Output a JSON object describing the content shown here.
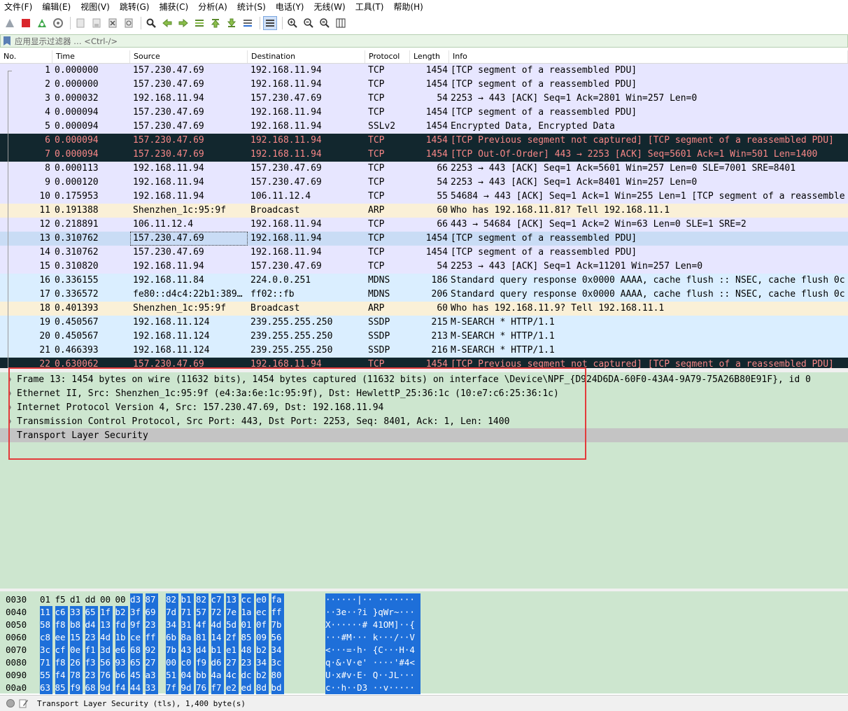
{
  "menu": [
    "文件(F)",
    "编辑(E)",
    "视图(V)",
    "跳转(G)",
    "捕获(C)",
    "分析(A)",
    "统计(S)",
    "电话(Y)",
    "无线(W)",
    "工具(T)",
    "帮助(H)"
  ],
  "filter": {
    "placeholder": "应用显示过滤器 … <Ctrl-/>"
  },
  "columns": [
    "No.",
    "Time",
    "Source",
    "Destination",
    "Protocol",
    "Length",
    "Info"
  ],
  "packets": [
    {
      "no": "1",
      "time": "0.000000",
      "src": "157.230.47.69",
      "dst": "192.168.11.94",
      "proto": "TCP",
      "len": "1454",
      "info": "[TCP segment of a reassembled PDU]",
      "cat": "tcp"
    },
    {
      "no": "2",
      "time": "0.000000",
      "src": "157.230.47.69",
      "dst": "192.168.11.94",
      "proto": "TCP",
      "len": "1454",
      "info": "[TCP segment of a reassembled PDU]",
      "cat": "tcp"
    },
    {
      "no": "3",
      "time": "0.000032",
      "src": "192.168.11.94",
      "dst": "157.230.47.69",
      "proto": "TCP",
      "len": "54",
      "info": "2253 → 443 [ACK] Seq=1 Ack=2801 Win=257 Len=0",
      "cat": "tcp"
    },
    {
      "no": "4",
      "time": "0.000094",
      "src": "157.230.47.69",
      "dst": "192.168.11.94",
      "proto": "TCP",
      "len": "1454",
      "info": "[TCP segment of a reassembled PDU]",
      "cat": "tcp"
    },
    {
      "no": "5",
      "time": "0.000094",
      "src": "157.230.47.69",
      "dst": "192.168.11.94",
      "proto": "SSLv2",
      "len": "1454",
      "info": "Encrypted Data, Encrypted Data",
      "cat": "tcp"
    },
    {
      "no": "6",
      "time": "0.000094",
      "src": "157.230.47.69",
      "dst": "192.168.11.94",
      "proto": "TCP",
      "len": "1454",
      "info": "[TCP Previous segment not captured]  [TCP segment of a reassembled PDU]",
      "cat": "bad"
    },
    {
      "no": "7",
      "time": "0.000094",
      "src": "157.230.47.69",
      "dst": "192.168.11.94",
      "proto": "TCP",
      "len": "1454",
      "info": "[TCP Out-Of-Order] 443 → 2253 [ACK] Seq=5601 Ack=1 Win=501 Len=1400",
      "cat": "bad"
    },
    {
      "no": "8",
      "time": "0.000113",
      "src": "192.168.11.94",
      "dst": "157.230.47.69",
      "proto": "TCP",
      "len": "66",
      "info": "2253 → 443 [ACK] Seq=1 Ack=5601 Win=257 Len=0 SLE=7001 SRE=8401",
      "cat": "tcp"
    },
    {
      "no": "9",
      "time": "0.000120",
      "src": "192.168.11.94",
      "dst": "157.230.47.69",
      "proto": "TCP",
      "len": "54",
      "info": "2253 → 443 [ACK] Seq=1 Ack=8401 Win=257 Len=0",
      "cat": "tcp"
    },
    {
      "no": "10",
      "time": "0.175953",
      "src": "192.168.11.94",
      "dst": "106.11.12.4",
      "proto": "TCP",
      "len": "55",
      "info": "54684 → 443 [ACK] Seq=1 Ack=1 Win=255 Len=1 [TCP segment of a reassemble",
      "cat": "tcp"
    },
    {
      "no": "11",
      "time": "0.191388",
      "src": "Shenzhen_1c:95:9f",
      "dst": "Broadcast",
      "proto": "ARP",
      "len": "60",
      "info": "Who has 192.168.11.81? Tell 192.168.11.1",
      "cat": "arp"
    },
    {
      "no": "12",
      "time": "0.218891",
      "src": "106.11.12.4",
      "dst": "192.168.11.94",
      "proto": "TCP",
      "len": "66",
      "info": "443 → 54684 [ACK] Seq=1 Ack=2 Win=63 Len=0 SLE=1 SRE=2",
      "cat": "tcp"
    },
    {
      "no": "13",
      "time": "0.310762",
      "src": "157.230.47.69",
      "dst": "192.168.11.94",
      "proto": "TCP",
      "len": "1454",
      "info": "[TCP segment of a reassembled PDU]",
      "cat": "sel"
    },
    {
      "no": "14",
      "time": "0.310762",
      "src": "157.230.47.69",
      "dst": "192.168.11.94",
      "proto": "TCP",
      "len": "1454",
      "info": "[TCP segment of a reassembled PDU]",
      "cat": "tcp"
    },
    {
      "no": "15",
      "time": "0.310820",
      "src": "192.168.11.94",
      "dst": "157.230.47.69",
      "proto": "TCP",
      "len": "54",
      "info": "2253 → 443 [ACK] Seq=1 Ack=11201 Win=257 Len=0",
      "cat": "tcp"
    },
    {
      "no": "16",
      "time": "0.336155",
      "src": "192.168.11.84",
      "dst": "224.0.0.251",
      "proto": "MDNS",
      "len": "186",
      "info": "Standard query response 0x0000 AAAA, cache flush :: NSEC, cache flush 0c",
      "cat": "udp"
    },
    {
      "no": "17",
      "time": "0.336572",
      "src": "fe80::d4c4:22b1:389…",
      "dst": "ff02::fb",
      "proto": "MDNS",
      "len": "206",
      "info": "Standard query response 0x0000 AAAA, cache flush :: NSEC, cache flush 0c",
      "cat": "udp"
    },
    {
      "no": "18",
      "time": "0.401393",
      "src": "Shenzhen_1c:95:9f",
      "dst": "Broadcast",
      "proto": "ARP",
      "len": "60",
      "info": "Who has 192.168.11.9? Tell 192.168.11.1",
      "cat": "arp"
    },
    {
      "no": "19",
      "time": "0.450567",
      "src": "192.168.11.124",
      "dst": "239.255.255.250",
      "proto": "SSDP",
      "len": "215",
      "info": "M-SEARCH * HTTP/1.1",
      "cat": "udp"
    },
    {
      "no": "20",
      "time": "0.450567",
      "src": "192.168.11.124",
      "dst": "239.255.255.250",
      "proto": "SSDP",
      "len": "213",
      "info": "M-SEARCH * HTTP/1.1",
      "cat": "udp"
    },
    {
      "no": "21",
      "time": "0.466393",
      "src": "192.168.11.124",
      "dst": "239.255.255.250",
      "proto": "SSDP",
      "len": "216",
      "info": "M-SEARCH * HTTP/1.1",
      "cat": "udp"
    },
    {
      "no": "22",
      "time": "0.630062",
      "src": "157.230.47.69",
      "dst": "192.168.11.94",
      "proto": "TCP",
      "len": "1454",
      "info": "[TCP Previous segment not captured]  [TCP segment of a reassembled PDU]",
      "cat": "bad"
    }
  ],
  "details": [
    {
      "text": "Frame 13: 1454 bytes on wire (11632 bits), 1454 bytes captured (11632 bits) on interface \\Device\\NPF_{D924D6DA-60F0-43A4-9A79-75A26B80E91F}, id 0",
      "expandable": true
    },
    {
      "text": "Ethernet II, Src: Shenzhen_1c:95:9f (e4:3a:6e:1c:95:9f), Dst: HewlettP_25:36:1c (10:e7:c6:25:36:1c)",
      "expandable": true
    },
    {
      "text": "Internet Protocol Version 4, Src: 157.230.47.69, Dst: 192.168.11.94",
      "expandable": true
    },
    {
      "text": "Transmission Control Protocol, Src Port: 443, Dst Port: 2253, Seq: 8401, Ack: 1, Len: 1400",
      "expandable": true
    },
    {
      "text": "Transport Layer Security",
      "expandable": false,
      "selected": true
    }
  ],
  "bytes": [
    {
      "offset": "0030",
      "hex": [
        "01",
        "f5",
        "d1",
        "dd",
        "00",
        "00",
        "d3",
        "87",
        "82",
        "b1",
        "82",
        "c7",
        "13",
        "cc",
        "e0",
        "fa"
      ],
      "hlStart": 6,
      "ascii": "······|··  ·······"
    },
    {
      "offset": "0040",
      "hex": [
        "11",
        "c6",
        "33",
        "65",
        "1f",
        "b2",
        "3f",
        "69",
        "7d",
        "71",
        "57",
        "72",
        "7e",
        "1a",
        "ec",
        "ff"
      ],
      "hlStart": 0,
      "ascii": "··3e··?i }qWr~···"
    },
    {
      "offset": "0050",
      "hex": [
        "58",
        "f8",
        "b8",
        "d4",
        "13",
        "fd",
        "9f",
        "23",
        "34",
        "31",
        "4f",
        "4d",
        "5d",
        "01",
        "0f",
        "7b"
      ],
      "hlStart": 0,
      "ascii": "X······# 41OM]··{"
    },
    {
      "offset": "0060",
      "hex": [
        "c8",
        "ee",
        "15",
        "23",
        "4d",
        "1b",
        "ce",
        "ff",
        "6b",
        "8a",
        "81",
        "14",
        "2f",
        "85",
        "09",
        "56"
      ],
      "hlStart": 0,
      "ascii": "···#M··· k···/··V"
    },
    {
      "offset": "0070",
      "hex": [
        "3c",
        "cf",
        "0e",
        "f1",
        "3d",
        "e6",
        "68",
        "92",
        "7b",
        "43",
        "d4",
        "b1",
        "e1",
        "48",
        "b2",
        "34"
      ],
      "hlStart": 0,
      "ascii": "<···=·h· {C···H·4"
    },
    {
      "offset": "0080",
      "hex": [
        "71",
        "f8",
        "26",
        "f3",
        "56",
        "93",
        "65",
        "27",
        "00",
        "c0",
        "f9",
        "d6",
        "27",
        "23",
        "34",
        "3c"
      ],
      "hlStart": 0,
      "ascii": "q·&·V·e' ····'#4<"
    },
    {
      "offset": "0090",
      "hex": [
        "55",
        "f4",
        "78",
        "23",
        "76",
        "b6",
        "45",
        "a3",
        "51",
        "04",
        "bb",
        "4a",
        "4c",
        "dc",
        "b2",
        "80"
      ],
      "hlStart": 0,
      "ascii": "U·x#v·E· Q··JL···"
    },
    {
      "offset": "00a0",
      "hex": [
        "63",
        "85",
        "f9",
        "68",
        "9d",
        "f4",
        "44",
        "33",
        "7f",
        "9d",
        "76",
        "f7",
        "e2",
        "ed",
        "8d",
        "bd"
      ],
      "hlStart": 0,
      "ascii": "c··h··D3 ··v·····"
    }
  ],
  "status": {
    "text": "Transport Layer Security (tls), 1,400 byte(s)"
  }
}
